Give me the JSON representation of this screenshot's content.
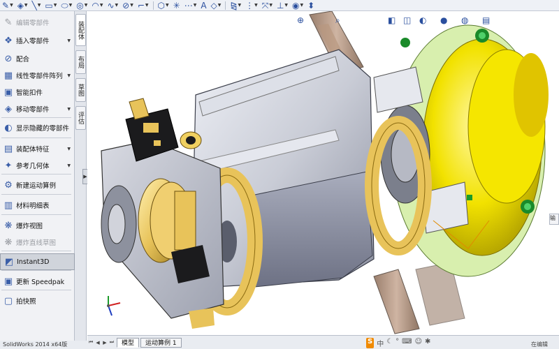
{
  "toolbar": {
    "buttons": [
      {
        "icon": "sketch-pencil-icon",
        "glyph": "✎",
        "dropdown": true
      },
      {
        "icon": "smart-dimension-icon",
        "glyph": "◈",
        "dropdown": true
      },
      {
        "icon": "line-icon",
        "glyph": "╲",
        "dropdown": true
      },
      {
        "icon": "rectangle-icon",
        "glyph": "▭",
        "dropdown": true
      },
      {
        "icon": "slot-icon",
        "glyph": "⬭",
        "dropdown": true
      },
      {
        "icon": "circle-icon",
        "glyph": "◎",
        "dropdown": true
      },
      {
        "icon": "arc-icon",
        "glyph": "◠",
        "dropdown": true
      },
      {
        "icon": "spline-icon",
        "glyph": "∿",
        "dropdown": true
      },
      {
        "icon": "ellipse-icon",
        "glyph": "⊘",
        "dropdown": true
      },
      {
        "icon": "fillet-icon",
        "glyph": "⌐",
        "dropdown": true
      },
      {
        "icon": "polygon-icon",
        "glyph": "⬡",
        "dropdown": true
      },
      {
        "icon": "point-icon",
        "glyph": "✳",
        "dropdown": false
      },
      {
        "icon": "centerline-icon",
        "glyph": "⋯",
        "dropdown": true
      },
      {
        "icon": "text-icon",
        "glyph": "A",
        "dropdown": false
      },
      {
        "icon": "offset-icon",
        "glyph": "◇",
        "dropdown": true
      },
      {
        "icon": "mirror-icon",
        "glyph": "⧎",
        "dropdown": true
      },
      {
        "icon": "pattern-icon",
        "glyph": "⋮",
        "dropdown": true
      },
      {
        "icon": "move-entities-icon",
        "glyph": "⤧",
        "dropdown": true
      },
      {
        "icon": "relations-icon",
        "glyph": "⊥",
        "dropdown": true
      },
      {
        "icon": "repair-sketch-icon",
        "glyph": "◉",
        "dropdown": true
      },
      {
        "icon": "quick-snaps-icon",
        "glyph": "⬍",
        "dropdown": false
      }
    ]
  },
  "command_manager": {
    "items": [
      {
        "label": "编辑零部件",
        "icon": "edit-component-icon",
        "glyph": "✎",
        "dropdown": false,
        "disabled": true
      },
      {
        "label": "插入零部件",
        "icon": "insert-component-icon",
        "glyph": "❖",
        "dropdown": true,
        "disabled": false
      },
      {
        "label": "配合",
        "icon": "mate-icon",
        "glyph": "⊘",
        "dropdown": false,
        "disabled": false
      },
      {
        "label": "线性零部件阵列",
        "icon": "linear-pattern-icon",
        "glyph": "▦",
        "dropdown": true,
        "disabled": false
      },
      {
        "label": "智能扣件",
        "icon": "smart-fasteners-icon",
        "glyph": "▣",
        "dropdown": false,
        "disabled": false
      },
      {
        "label": "移动零部件",
        "icon": "move-component-icon",
        "glyph": "◈",
        "dropdown": true,
        "disabled": false
      },
      {
        "label": "显示隐藏的零部件",
        "icon": "show-hidden-icon",
        "glyph": "◐",
        "dropdown": false,
        "disabled": false
      },
      {
        "label": "装配体特征",
        "icon": "assembly-features-icon",
        "glyph": "▤",
        "dropdown": true,
        "disabled": false
      },
      {
        "label": "参考几何体",
        "icon": "reference-geometry-icon",
        "glyph": "✦",
        "dropdown": true,
        "disabled": false
      },
      {
        "label": "新建运动算例",
        "icon": "motion-study-icon",
        "glyph": "⚙",
        "dropdown": false,
        "disabled": false
      },
      {
        "label": "材料明细表",
        "icon": "bom-icon",
        "glyph": "▥",
        "dropdown": false,
        "disabled": false
      },
      {
        "label": "爆炸视图",
        "icon": "exploded-view-icon",
        "glyph": "❋",
        "dropdown": false,
        "disabled": false
      },
      {
        "label": "爆炸直线草图",
        "icon": "explode-line-sketch-icon",
        "glyph": "❋",
        "dropdown": false,
        "disabled": true
      },
      {
        "label": "Instant3D",
        "icon": "instant3d-icon",
        "glyph": "◩",
        "dropdown": false,
        "disabled": false,
        "active": true
      },
      {
        "label": "更新 Speedpak",
        "icon": "speedpak-icon",
        "glyph": "▣",
        "dropdown": false,
        "disabled": false
      },
      {
        "label": "拍快照",
        "icon": "snapshot-icon",
        "glyph": "▢",
        "dropdown": false,
        "disabled": false
      }
    ]
  },
  "vertical_tabs": [
    "装配体",
    "布局",
    "草图",
    "评估"
  ],
  "viewport": {
    "heads_up_icons": [
      "zoom-icon",
      "view-orientation-icon",
      "display-style-icon",
      "hide-show-icon",
      "appearance-icon",
      "scene-icon",
      "view-settings-icon"
    ]
  },
  "bottom_tabs": {
    "tabs": [
      {
        "label": "模型",
        "selected": true
      },
      {
        "label": "运动算例 1",
        "selected": false
      }
    ]
  },
  "status_bar": {
    "left_text": "SolidWorks 2014 x64版",
    "right_text": "在编辑",
    "side_tab_text": "输"
  },
  "colors": {
    "accent": "#2a4f9e",
    "housing_gray": "#c9ccd6",
    "yellow_part": "#f2e200",
    "green_part": "#cfe8a0",
    "gold_part": "#e8c35a"
  }
}
